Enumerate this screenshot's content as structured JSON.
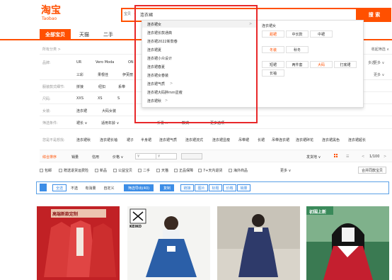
{
  "header": {
    "logo": "淘宝",
    "logo_sub": "Taobao",
    "search_scope": "宝贝",
    "search_value": "连衣裙",
    "search_button": "搜 索"
  },
  "tabs": [
    "全部宝贝",
    "天猫",
    "二手"
  ],
  "filters": {
    "row0_label": "所有分类 >",
    "brand_label": "品牌:",
    "brands_row1": [
      "UR",
      "Vero Moda",
      "ON"
    ],
    "brands_row2": [
      "三彩",
      "果根佳",
      "伊芙丽"
    ],
    "style_label": "服装款式细节:",
    "styles": [
      "拼接",
      "纽扣",
      "系带"
    ],
    "size_label": "尺码:",
    "sizes": [
      "XXS",
      "XS",
      "S"
    ],
    "cat_label": "女装:",
    "cats": [
      "连衣裙",
      "大码女装"
    ],
    "cond_label": "筛选条件:",
    "conds": [
      "裙长 ∨",
      "适用年龄 ∨"
    ],
    "collapse_label": "折叠 ∧",
    "type_label": "款式",
    "more_options": "更多选项",
    "right_more_top": "多选",
    "right_more2": "更多 ∨",
    "right_more3": "收起筛选 ∧"
  },
  "related": {
    "label": "您是不是想找:",
    "items": [
      "连衣裙秋",
      "连衣裙长袖",
      "裙子",
      "半身裙",
      "连衣裙气质",
      "连衣裙流式",
      "连衣裙显瘦",
      "吊带裙",
      "长裙",
      "吊带连衣裙",
      "连衣裙碎花",
      "连衣裙黑色",
      "连衣裙超长"
    ]
  },
  "dropdown": {
    "suggestions": [
      "连衣裙女",
      "连衣裙长款通典",
      "连衣裙2022新款春",
      "连衣裙夏",
      "连衣裙小众设计",
      "连衣裙春夏",
      "连衣裙女春装",
      "连衣裙气质",
      "连衣裙大码胖mm显瘦",
      "连衣裙秋"
    ],
    "panel_title": "连衣裙女",
    "chips_row1": [
      "甜裙",
      "中长款",
      "中裙"
    ],
    "chips_row2": [
      "冬装",
      "秋冬"
    ],
    "chips_row3": [
      "短裙",
      "两件套",
      "大码",
      "打底裙"
    ],
    "chips_row4": [
      "长袖"
    ],
    "arrow": ">"
  },
  "sort": {
    "items": [
      "综合排序",
      "销量",
      "信用",
      "价格 ∨"
    ],
    "price_from": "¥",
    "price_to": "¥",
    "ship_to": "发货地 ∨",
    "pagination": "1/100",
    "prev": "<",
    "next": ">"
  },
  "checks": [
    "包邮",
    "赠送退货运费险",
    "新品",
    "公益宝贝",
    "二手",
    "天猫",
    "正品保障",
    "7+天内退货",
    "海外商品"
  ],
  "checks_more": "更多 ∨",
  "checks_right": "合并同款宝贝",
  "toolbar": {
    "items": [
      "全选",
      "不选",
      "有消量",
      "自定义"
    ],
    "export_btn": "筛选导出(40)",
    "copy_btn": "复制",
    "link_items": [
      "链接",
      "图片",
      "标题",
      "价格",
      "销量"
    ]
  },
  "products": [
    {
      "badge": "高端新款定制",
      "colors": [
        "#c8272b",
        "#e8d6c8"
      ]
    },
    {
      "badge": "KEIKO",
      "colors": [
        "#2b5fa8",
        "#f2f2f2"
      ]
    },
    {
      "badge": "",
      "colors": [
        "#2e3a6a",
        "#d6d0c4"
      ]
    },
    {
      "badge": "初围上新",
      "colors": [
        "#c41f2f",
        "#3a8a5a"
      ]
    }
  ]
}
